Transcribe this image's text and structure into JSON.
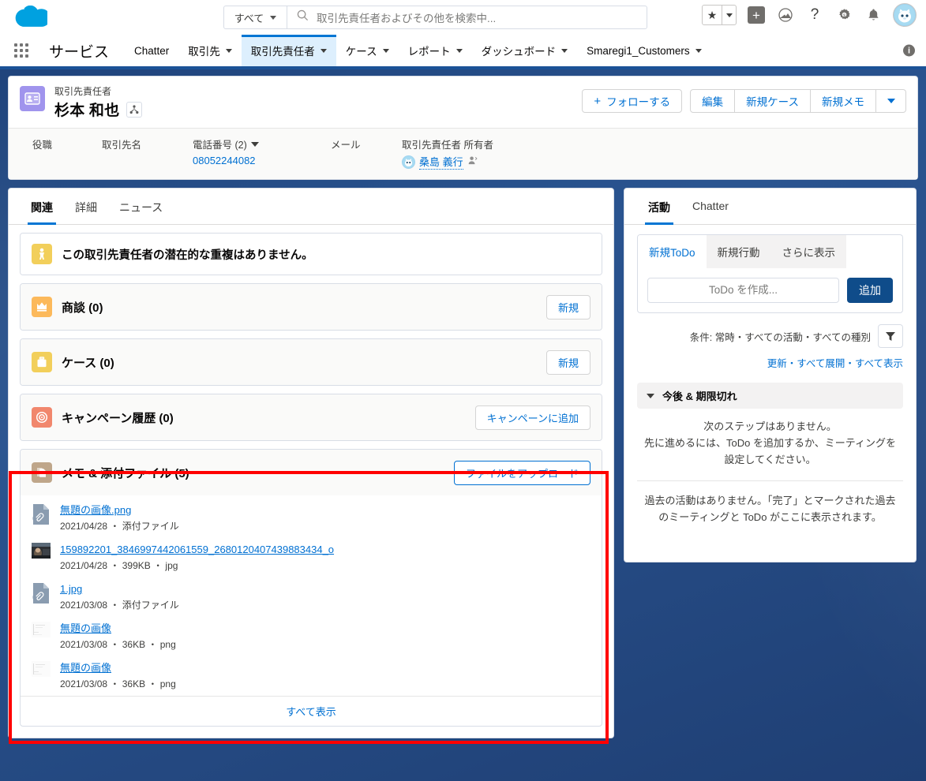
{
  "header": {
    "logo_icon": "salesforce-cloud-logo",
    "search": {
      "scope_label": "すべて",
      "placeholder": "取引先責任者およびその他を検索中...",
      "search_icon": "search-icon"
    },
    "icons": [
      {
        "name": "favorites-star-icon",
        "glyph": "★"
      },
      {
        "name": "favorites-dropdown-icon"
      },
      {
        "name": "global-actions-plus-icon",
        "glyph": "+"
      },
      {
        "name": "app-launcher-cloud-icon"
      },
      {
        "name": "help-icon",
        "glyph": "?"
      },
      {
        "name": "setup-gear-icon"
      },
      {
        "name": "notifications-bell-icon"
      },
      {
        "name": "user-avatar-icon"
      }
    ]
  },
  "nav": {
    "app_name": "サービス",
    "waffle_icon": "app-launcher-grid-icon",
    "info_icon": "info-icon",
    "items": [
      {
        "label": "Chatter",
        "has_caret": false,
        "active": false
      },
      {
        "label": "取引先",
        "has_caret": true,
        "active": false
      },
      {
        "label": "取引先責任者",
        "has_caret": true,
        "active": true
      },
      {
        "label": "ケース",
        "has_caret": true,
        "active": false
      },
      {
        "label": "レポート",
        "has_caret": true,
        "active": false
      },
      {
        "label": "ダッシュボード",
        "has_caret": true,
        "active": false
      },
      {
        "label": "Smaregi1_Customers",
        "has_caret": true,
        "active": false
      }
    ]
  },
  "record": {
    "object_label": "取引先責任者",
    "name": "杉本 和也",
    "record_icon": "contact-id-card-icon",
    "hierarchy_icon": "contact-hierarchy-icon",
    "follow_button": "フォローする",
    "actions": [
      "編集",
      "新規ケース",
      "新規メモ"
    ],
    "more_actions_icon": "chevron-down-icon",
    "fields": [
      {
        "label": "役職",
        "value": ""
      },
      {
        "label": "取引先名",
        "value": ""
      },
      {
        "label": "電話番号 (2)",
        "value": "08052244082",
        "has_dropdown": true
      },
      {
        "label": "メール",
        "value": ""
      },
      {
        "label": "取引先責任者 所有者",
        "value": "桑島 義行",
        "is_owner": true
      }
    ]
  },
  "main": {
    "tabs": [
      {
        "label": "関連",
        "active": true
      },
      {
        "label": "詳細",
        "active": false
      },
      {
        "label": "ニュース",
        "active": false
      }
    ],
    "duplicate_card": {
      "icon": "duplicate-check-icon",
      "icon_color": "#f2cf5b",
      "text": "この取引先責任者の潜在的な重複はありません。"
    },
    "related_lists": [
      {
        "icon": "opportunity-crown-icon",
        "icon_color": "#fcb95b",
        "title": "商談 (0)",
        "button": "新規"
      },
      {
        "icon": "case-briefcase-icon",
        "icon_color": "#f2cf5b",
        "title": "ケース (0)",
        "button": "新規"
      },
      {
        "icon": "campaign-target-icon",
        "icon_color": "#f1876d",
        "title": "キャンペーン履歴 (0)",
        "button": "キャンペーンに追加"
      }
    ],
    "notes_card": {
      "icon": "notes-attachments-icon",
      "icon_color": "#bfa68a",
      "title": "メモ & 添付ファイル (5)",
      "button": "ファイルをアップロード",
      "view_all": "すべて表示",
      "files": [
        {
          "name": "無題の画像.png",
          "meta": "2021/04/28 ・ 添付ファイル",
          "thumb": "attachment-doc-icon"
        },
        {
          "name": "159892201_3846997442061559_2680120407439883434_o",
          "meta": "2021/04/28 ・ 399KB ・ jpg",
          "thumb": "photo-thumbnail"
        },
        {
          "name": "1.jpg",
          "meta": "2021/03/08 ・ 添付ファイル",
          "thumb": "attachment-doc-icon"
        },
        {
          "name": "無題の画像",
          "meta": "2021/03/08 ・ 36KB ・ png",
          "thumb": "light-image-thumbnail"
        },
        {
          "name": "無題の画像",
          "meta": "2021/03/08 ・ 36KB ・ png",
          "thumb": "light-image-thumbnail"
        }
      ]
    }
  },
  "sidebar": {
    "tabs": [
      {
        "label": "活動",
        "active": true
      },
      {
        "label": "Chatter",
        "active": false
      }
    ],
    "subtabs": [
      {
        "label": "新規ToDo",
        "active": true
      },
      {
        "label": "新規行動",
        "active": false
      },
      {
        "label": "さらに表示",
        "active": false
      }
    ],
    "todo_placeholder": "ToDo を作成...",
    "add_button": "追加",
    "filter_text": "条件: 常時・すべての活動・すべての種別",
    "filter_icon": "filter-funnel-icon",
    "links": "更新・すべて展開・すべて表示",
    "section": {
      "chevron_icon": "chevron-down-icon",
      "title": "今後 & 期限切れ",
      "empty_line1": "次のステップはありません。",
      "empty_line2": "先に進めるには、ToDo を追加するか、ミーティングを設定してください。"
    },
    "past_empty": "過去の活動はありません。「完了」とマークされた過去のミーティングと ToDo がここに表示されます。"
  },
  "annotation": {
    "highlight_color": "#ff0000"
  }
}
